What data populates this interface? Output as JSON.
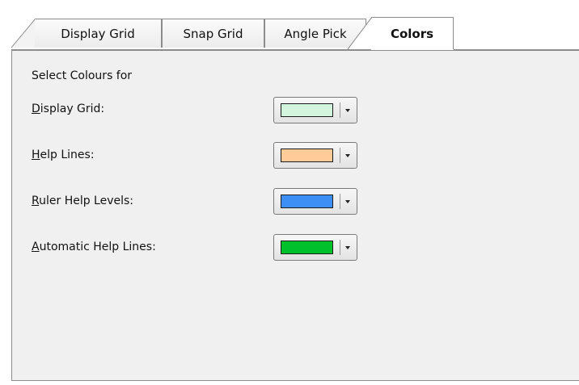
{
  "tabs": [
    {
      "label": "Display Grid",
      "active": false
    },
    {
      "label": "Snap Grid",
      "active": false
    },
    {
      "label": "Angle Pick",
      "active": false
    },
    {
      "label": "Colors",
      "active": true
    }
  ],
  "panel": {
    "heading": "Select Colours for",
    "rows": [
      {
        "mnemonic": "D",
        "rest": "isplay Grid:",
        "color": "#d3f5de"
      },
      {
        "mnemonic": "H",
        "rest": "elp Lines:",
        "color": "#ffcc99"
      },
      {
        "mnemonic": "R",
        "rest": "uler Help Levels:",
        "color": "#3d8ff5"
      },
      {
        "mnemonic": "A",
        "rest": "utomatic Help Lines:",
        "color": "#00c12c"
      }
    ]
  }
}
